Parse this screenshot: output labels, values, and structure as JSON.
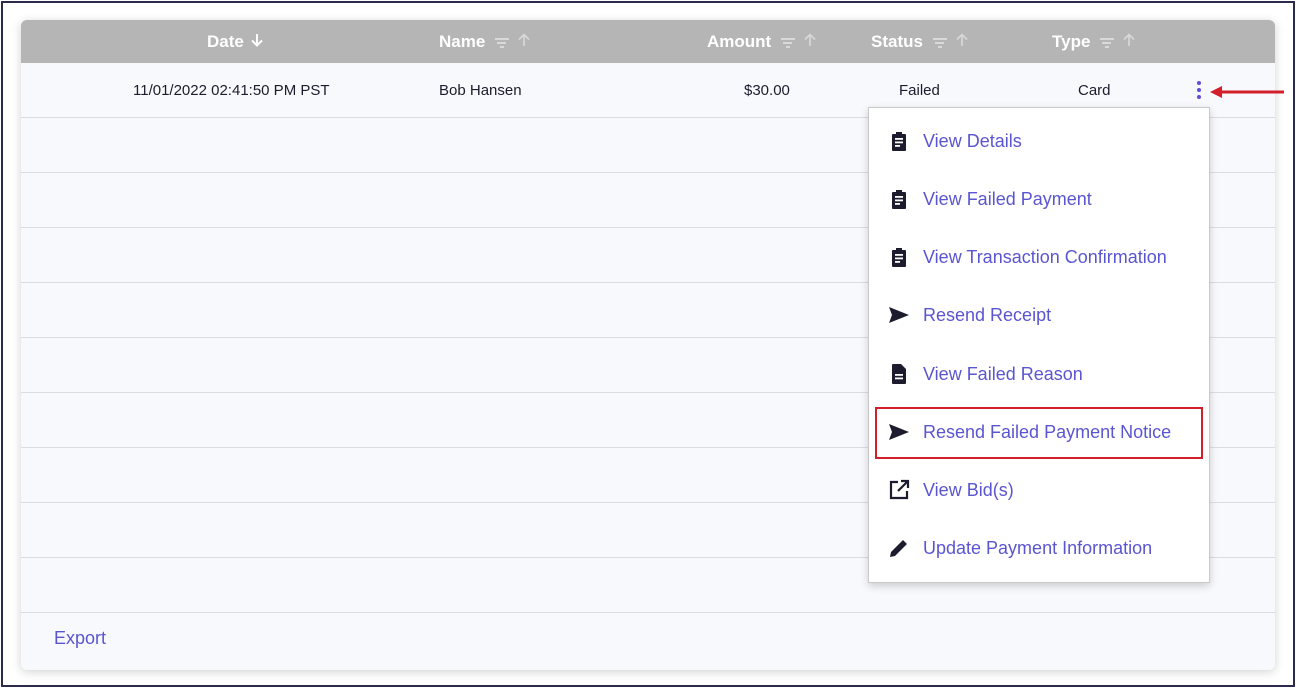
{
  "table": {
    "columns": [
      {
        "label": "Date",
        "sort_icon": "arrow-down-icon"
      },
      {
        "label": "Name",
        "sort_icon": "arrow-up-icon",
        "filter_icon": "filter-icon"
      },
      {
        "label": "Amount",
        "sort_icon": "arrow-up-icon",
        "filter_icon": "filter-icon"
      },
      {
        "label": "Status",
        "sort_icon": "arrow-up-icon",
        "filter_icon": "filter-icon"
      },
      {
        "label": "Type",
        "sort_icon": "arrow-up-icon",
        "filter_icon": "filter-icon"
      }
    ],
    "rows": [
      {
        "date": "11/01/2022 02:41:50 PM PST",
        "name": "Bob Hansen",
        "amount": "$30.00",
        "status": "Failed",
        "type": "Card"
      }
    ]
  },
  "menu": {
    "items": [
      {
        "label": "View Details",
        "icon": "clipboard-icon"
      },
      {
        "label": "View Failed Payment",
        "icon": "clipboard-icon"
      },
      {
        "label": "View Transaction Confirmation",
        "icon": "clipboard-icon"
      },
      {
        "label": "Resend Receipt",
        "icon": "send-icon"
      },
      {
        "label": "View Failed Reason",
        "icon": "document-icon"
      },
      {
        "label": "Resend Failed Payment Notice",
        "icon": "send-icon",
        "highlighted": true
      },
      {
        "label": "View Bid(s)",
        "icon": "external-link-icon"
      },
      {
        "label": "Update Payment Information",
        "icon": "pencil-icon"
      }
    ]
  },
  "footer": {
    "export_label": "Export"
  },
  "colors": {
    "accent": "#5a55d0",
    "header_bg": "#b5b5b5",
    "highlight": "#d21f2a"
  }
}
